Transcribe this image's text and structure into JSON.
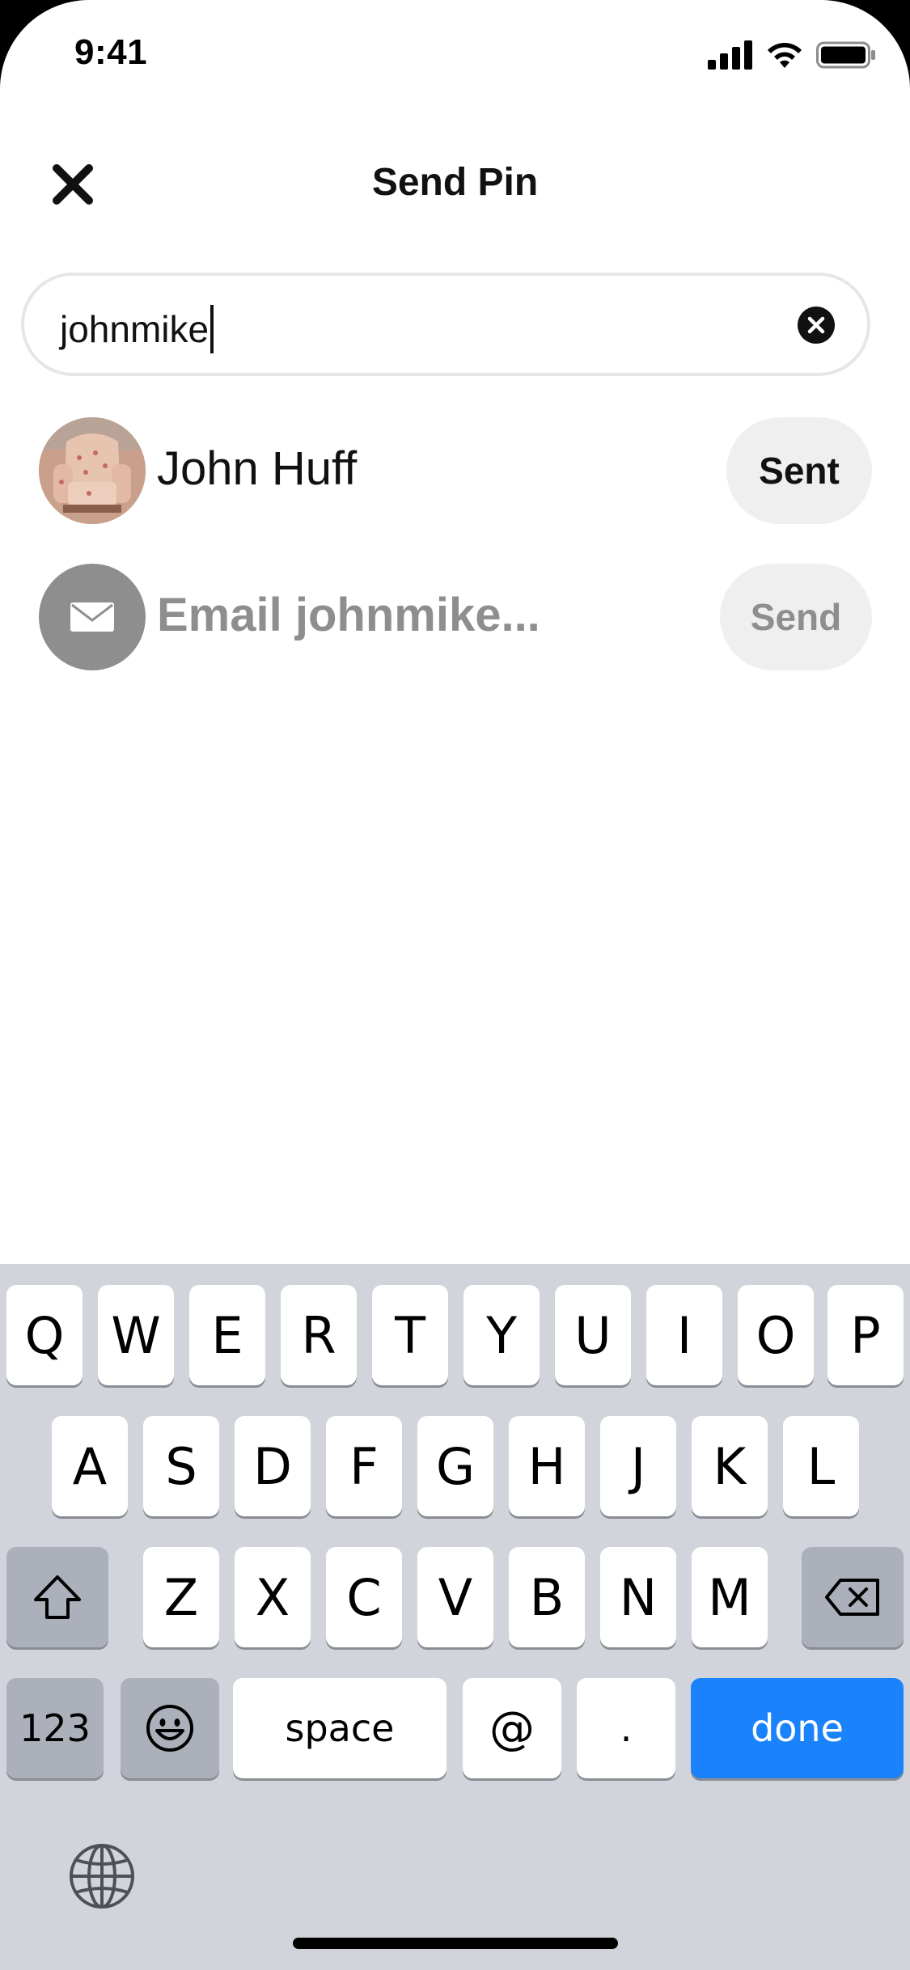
{
  "status_bar": {
    "time": "9:41"
  },
  "header": {
    "title": "Send Pin"
  },
  "search": {
    "value": "johnmike"
  },
  "results": [
    {
      "name": "John Huff",
      "action": "Sent"
    },
    {
      "name": "Email johnmike...",
      "action": "Send"
    }
  ],
  "keyboard": {
    "row1": [
      "Q",
      "W",
      "E",
      "R",
      "T",
      "Y",
      "U",
      "I",
      "O",
      "P"
    ],
    "row2": [
      "A",
      "S",
      "D",
      "F",
      "G",
      "H",
      "J",
      "K",
      "L"
    ],
    "row3": [
      "Z",
      "X",
      "C",
      "V",
      "B",
      "N",
      "M"
    ],
    "numbers_label": "123",
    "space_label": "space",
    "at_label": "@",
    "period_label": ".",
    "done_label": "done"
  },
  "colors": {
    "accent": "#1a82fb",
    "muted_text": "#8e8e8e",
    "pill_bg": "#efefef",
    "keyboard_bg": "#d1d4db"
  }
}
